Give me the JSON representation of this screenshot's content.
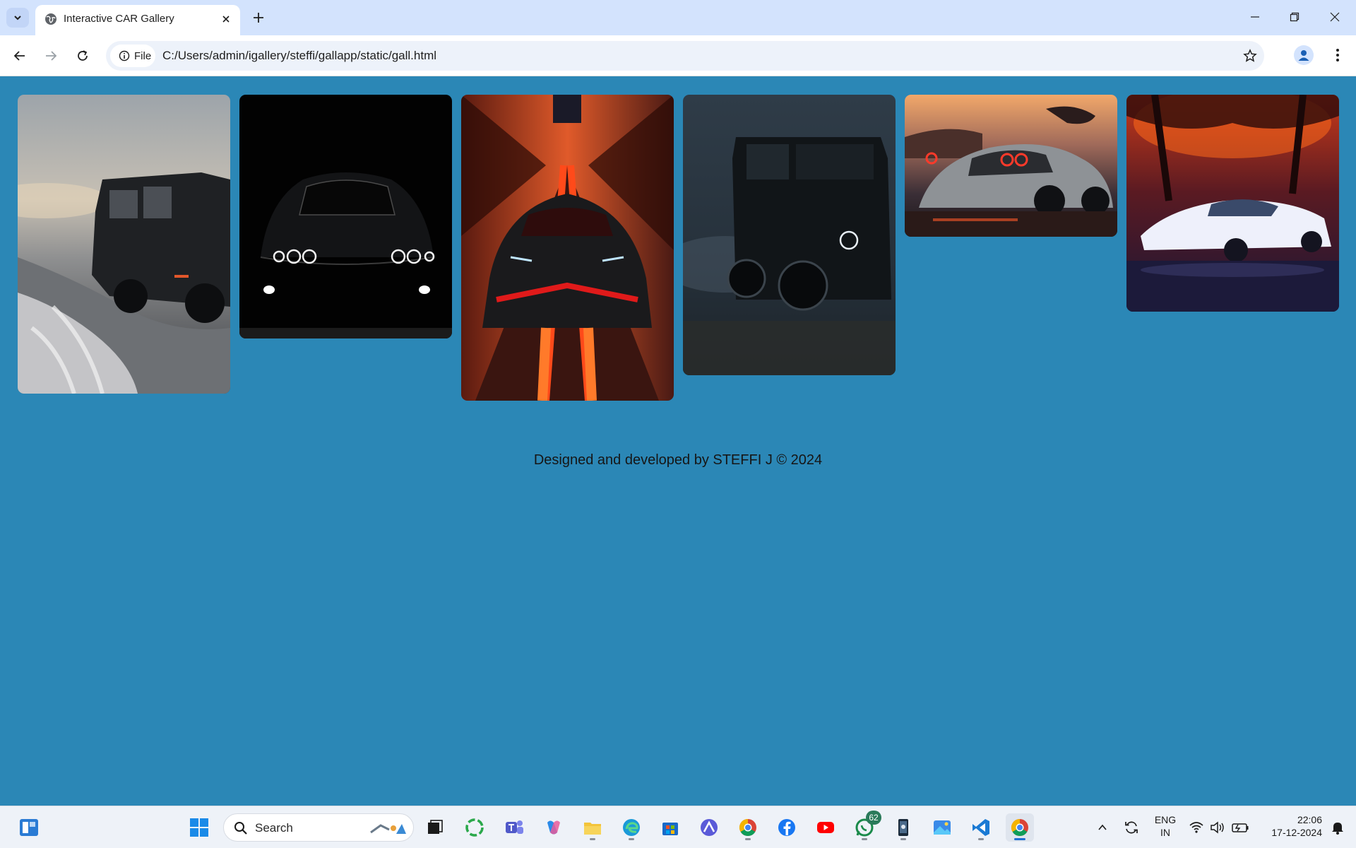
{
  "browser": {
    "tab_title": "Interactive CAR Gallery",
    "chip_label": "File",
    "url": "C:/Users/admin/igallery/steffi/gallapp/static/gall.html"
  },
  "gallery": {
    "images": [
      {
        "name": "black-suv-on-snowy-shore"
      },
      {
        "name": "black-sedan-headlights"
      },
      {
        "name": "red-black-supercar-speed"
      },
      {
        "name": "black-suv-in-fog"
      },
      {
        "name": "silver-sports-car-sunset"
      },
      {
        "name": "white-sports-car-red-trees"
      }
    ],
    "footer": "Designed and developed by STEFFI J © 2024"
  },
  "taskbar": {
    "search_placeholder": "Search",
    "whatsapp_badge": "62",
    "lang_line1": "ENG",
    "lang_line2": "IN",
    "time": "22:06",
    "date": "17-12-2024"
  },
  "colors": {
    "page_background": "#2b87b6",
    "tabbar": "#d3e3fd",
    "accent": "#1f6fd1"
  }
}
